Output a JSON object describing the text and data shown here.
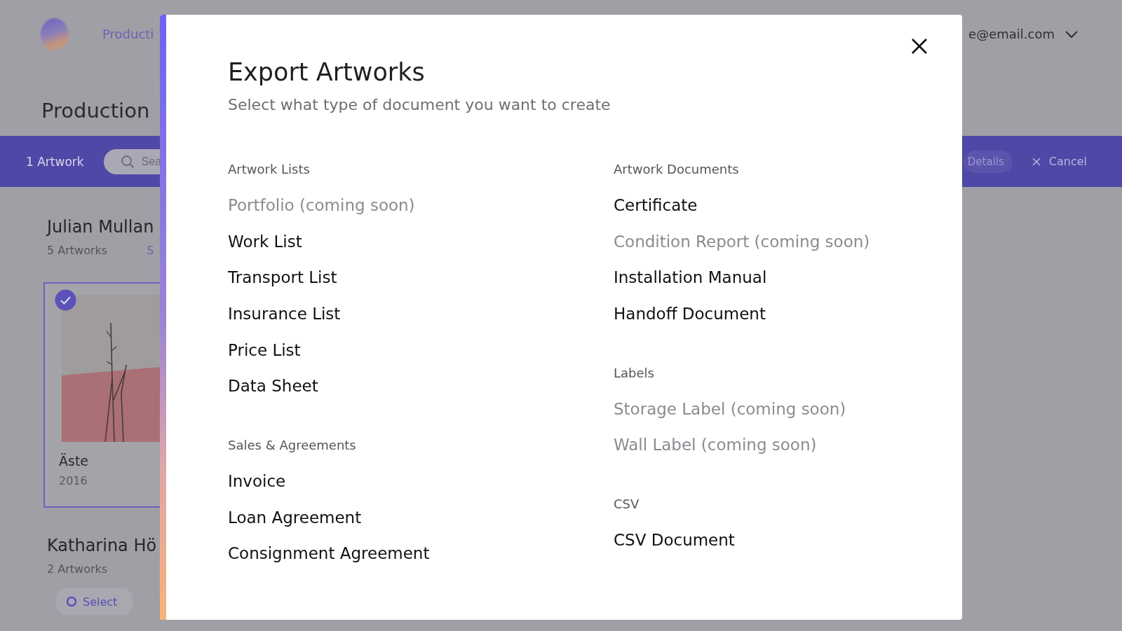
{
  "header": {
    "nav_link": "Producti",
    "account": "e@email.com"
  },
  "page_title": "Production",
  "action_bar": {
    "count": "1 Artwork",
    "search": {
      "placeholder": "Sea"
    },
    "buttons": [
      {
        "kind": "pill",
        "label": "Details"
      },
      {
        "kind": "cancel",
        "label": "Cancel"
      }
    ]
  },
  "groups": [
    {
      "artist": "Julian Mullan",
      "count": "5 Artworks",
      "link": "S",
      "artworks": [
        {
          "title": "Äste",
          "year": "2016",
          "selected": true
        }
      ]
    },
    {
      "artist": "Katharina Hö",
      "count": "2 Artworks",
      "select_button": "Select"
    }
  ],
  "modal": {
    "title": "Export Artworks",
    "subtitle": "Select what type of document you want to create",
    "columns": [
      [
        {
          "heading": "Artwork Lists",
          "items": [
            {
              "label": "Portfolio (coming soon)",
              "disabled": true
            },
            {
              "label": "Work List",
              "disabled": false
            },
            {
              "label": "Transport List",
              "disabled": false
            },
            {
              "label": "Insurance List",
              "disabled": false
            },
            {
              "label": "Price List",
              "disabled": false
            },
            {
              "label": "Data Sheet",
              "disabled": false
            }
          ]
        },
        {
          "heading": "Sales & Agreements",
          "items": [
            {
              "label": "Invoice",
              "disabled": false
            },
            {
              "label": "Loan Agreement",
              "disabled": false
            },
            {
              "label": "Consignment Agreement",
              "disabled": false
            }
          ]
        }
      ],
      [
        {
          "heading": "Artwork Documents",
          "items": [
            {
              "label": "Certificate",
              "disabled": false
            },
            {
              "label": "Condition Report (coming soon)",
              "disabled": true
            },
            {
              "label": "Installation Manual",
              "disabled": false
            },
            {
              "label": "Handoff Document",
              "disabled": false
            }
          ]
        },
        {
          "heading": "Labels",
          "items": [
            {
              "label": "Storage Label (coming soon)",
              "disabled": true
            },
            {
              "label": "Wall Label (coming soon)",
              "disabled": true
            }
          ]
        },
        {
          "heading": "CSV",
          "items": [
            {
              "label": "CSV Document",
              "disabled": false
            }
          ]
        }
      ]
    ]
  }
}
